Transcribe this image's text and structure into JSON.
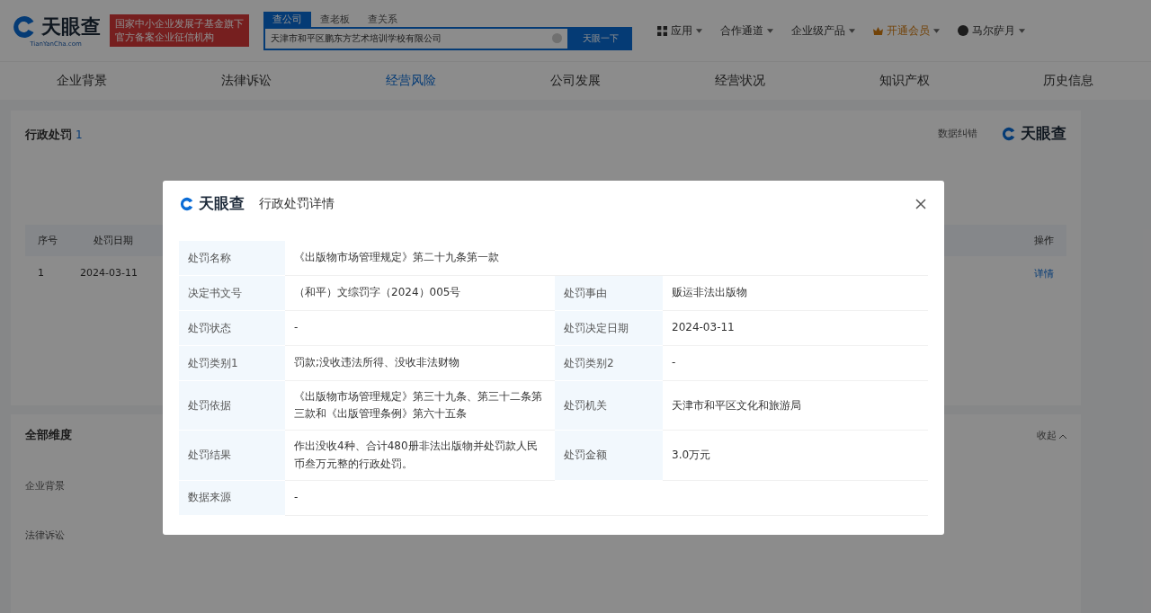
{
  "header": {
    "logo": "天眼查",
    "logo_sub": "TianYanCha.com",
    "banner": [
      "国家中小企业发展子基金旗下",
      "官方备案企业征信机构"
    ],
    "search_tabs": [
      {
        "label": "查公司",
        "selected": true
      },
      {
        "label": "查老板",
        "selected": false
      },
      {
        "label": "查关系",
        "selected": false
      }
    ],
    "search_value": "天津市和平区鹏东方艺术培训学校有限公司",
    "search_button": "天眼一下",
    "nav": [
      {
        "label": "应用",
        "kind": "apps"
      },
      {
        "label": "合作通道",
        "kind": "plain"
      },
      {
        "label": "企业级产品",
        "kind": "plain"
      },
      {
        "label": "开通会员",
        "kind": "vip"
      },
      {
        "label": "马尔萨月",
        "kind": "user"
      }
    ]
  },
  "tabs": [
    {
      "label": "企业背景",
      "selected": false
    },
    {
      "label": "法律诉讼",
      "selected": false
    },
    {
      "label": "经营风险",
      "selected": true
    },
    {
      "label": "公司发展",
      "selected": false
    },
    {
      "label": "经营状况",
      "selected": false
    },
    {
      "label": "知识产权",
      "selected": false
    },
    {
      "label": "历史信息",
      "selected": false
    }
  ],
  "section": {
    "title": "行政处罚",
    "count": "1",
    "action": "数据纠错",
    "logo": "天眼查",
    "table": {
      "columns": [
        "序号",
        "处罚日期",
        "操作"
      ],
      "rows": [
        {
          "index": "1",
          "date": "2024-03-11",
          "action": "详情"
        }
      ]
    }
  },
  "dimensions": {
    "title": "全部维度",
    "toggle": "收起",
    "rows": [
      "企业背景",
      "法律诉讼"
    ]
  },
  "modal": {
    "logo": "天眼查",
    "title": "行政处罚详情",
    "fields": [
      {
        "label": "处罚名称",
        "value": "《出版物市场管理规定》第二十九条第一款",
        "kind": "wide"
      },
      {
        "label": "决定书文号",
        "value": "（和平）文综罚字（2024）005号",
        "kind": "pair"
      },
      {
        "label": "处罚事由",
        "value": "贩运非法出版物",
        "kind": "pair"
      },
      {
        "label": "处罚状态",
        "value": "-",
        "kind": "pair"
      },
      {
        "label": "处罚决定日期",
        "value": "2024-03-11",
        "kind": "pair"
      },
      {
        "label": "处罚类别1",
        "value": "罚款;没收违法所得、没收非法财物",
        "kind": "pair"
      },
      {
        "label": "处罚类别2",
        "value": "-",
        "kind": "pair"
      },
      {
        "label": "处罚依据",
        "value": "《出版物市场管理规定》第三十九条、第三十二条第三款和《出版管理条例》第六十五条",
        "kind": "pair"
      },
      {
        "label": "处罚机关",
        "value": "天津市和平区文化和旅游局",
        "kind": "pair"
      },
      {
        "label": "处罚结果",
        "value": "作出没收4种、合计480册非法出版物并处罚款人民币叁万元整的行政处罚。",
        "kind": "pair"
      },
      {
        "label": "处罚金额",
        "value": "3.0万元",
        "kind": "pair"
      },
      {
        "label": "数据来源",
        "value": "-",
        "kind": "wide"
      }
    ]
  }
}
